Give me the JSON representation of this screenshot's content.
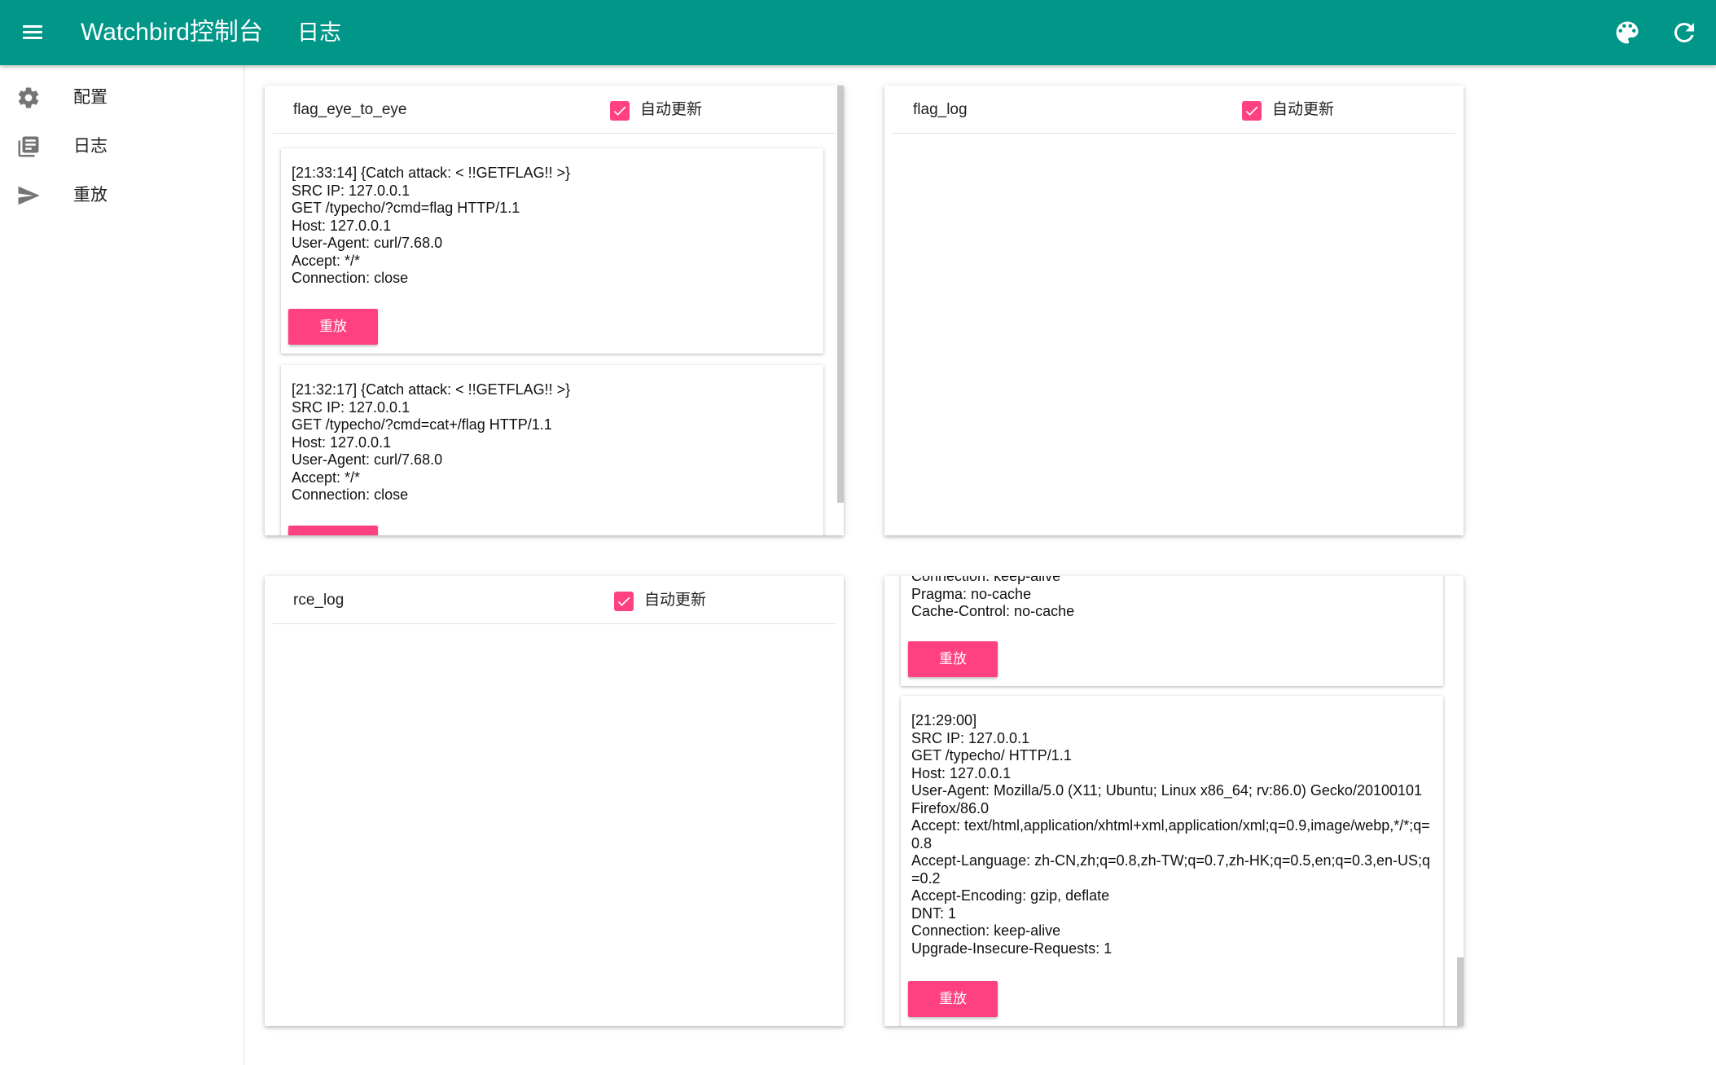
{
  "appbar": {
    "title": "Watchbird控制台",
    "subtitle": "日志",
    "icons": [
      "menu-icon",
      "palette-icon",
      "refresh-icon"
    ],
    "color": "#009688"
  },
  "sidebar": {
    "items": [
      {
        "label": "配置",
        "icon": "gear-icon"
      },
      {
        "label": "日志",
        "icon": "library-books-icon"
      },
      {
        "label": "重放",
        "icon": "send-icon"
      }
    ]
  },
  "accent_color": "#ff4081",
  "cards": [
    {
      "title": "flag_eye_to_eye",
      "auto_update_label": "自动更新",
      "auto_update": true,
      "entries": [
        {
          "text": "[21:33:14] {Catch attack: < !!GETFLAG!! >}\nSRC IP: 127.0.0.1\nGET /typecho/?cmd=flag HTTP/1.1\nHost: 127.0.0.1\nUser-Agent: curl/7.68.0\nAccept: */*\nConnection: close",
          "button_label": "重放"
        },
        {
          "text": "[21:32:17] {Catch attack: < !!GETFLAG!! >}\nSRC IP: 127.0.0.1\nGET /typecho/?cmd=cat+/flag HTTP/1.1\nHost: 127.0.0.1\nUser-Agent: curl/7.68.0\nAccept: */*\nConnection: close",
          "button_label": "重放"
        }
      ]
    },
    {
      "title": "flag_log",
      "auto_update_label": "自动更新",
      "auto_update": true,
      "entries": []
    },
    {
      "title": "rce_log",
      "auto_update_label": "自动更新",
      "auto_update": true,
      "entries": []
    },
    {
      "title": "",
      "entries": [
        {
          "text": "Connection: keep-alive\nPragma: no-cache\nCache-Control: no-cache",
          "button_label": "重放"
        },
        {
          "text": "[21:29:00]\nSRC IP: 127.0.0.1\nGET /typecho/ HTTP/1.1\nHost: 127.0.0.1\nUser-Agent: Mozilla/5.0 (X11; Ubuntu; Linux x86_64; rv:86.0) Gecko/20100101 Firefox/86.0\nAccept: text/html,application/xhtml+xml,application/xml;q=0.9,image/webp,*/*;q=0.8\nAccept-Language: zh-CN,zh;q=0.8,zh-TW;q=0.7,zh-HK;q=0.5,en;q=0.3,en-US;q=0.2\nAccept-Encoding: gzip, deflate\nDNT: 1\nConnection: keep-alive\nUpgrade-Insecure-Requests: 1",
          "button_label": "重放"
        }
      ]
    }
  ]
}
